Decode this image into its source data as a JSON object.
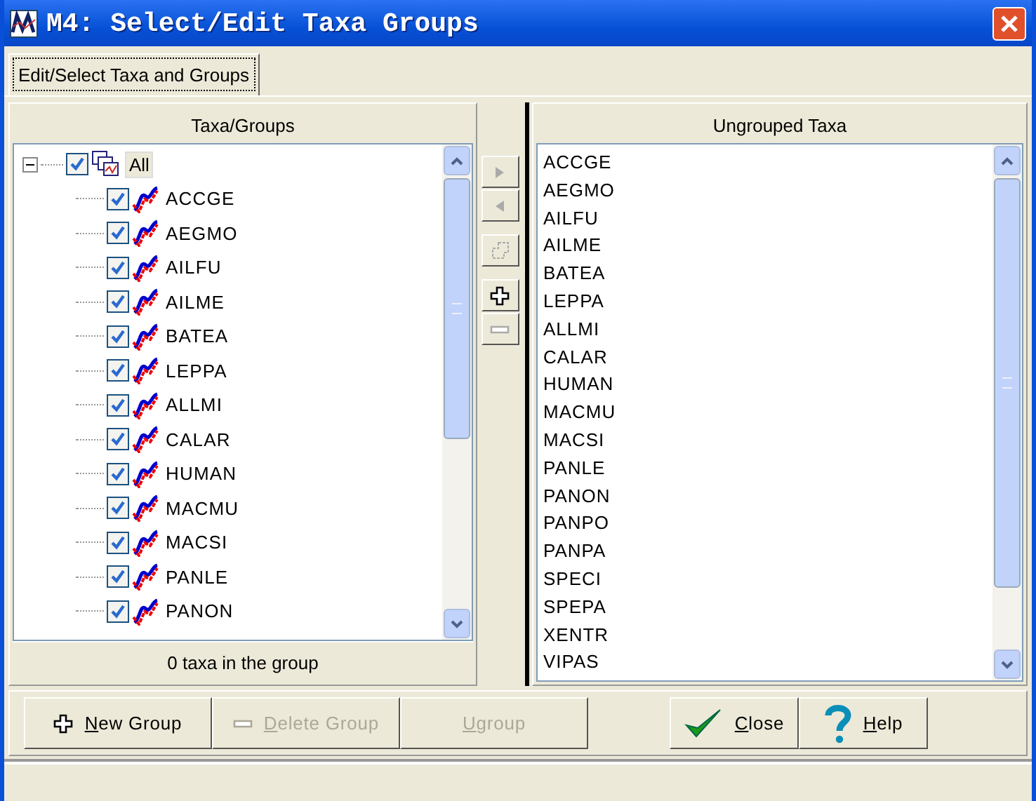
{
  "window": {
    "title": "M4: Select/Edit Taxa Groups"
  },
  "tabs": [
    {
      "label": "Edit/Select Taxa and Groups",
      "selected": true
    }
  ],
  "groups_panel": {
    "header": "Taxa/Groups",
    "footer": "0 taxa in the group",
    "tree": [
      {
        "label": "All",
        "checked": true,
        "expanded": true,
        "selected": true,
        "kind": "group",
        "children": [
          {
            "label": "ACCGE",
            "checked": true,
            "kind": "taxon"
          },
          {
            "label": "AEGMO",
            "checked": true,
            "kind": "taxon"
          },
          {
            "label": "AILFU",
            "checked": true,
            "kind": "taxon"
          },
          {
            "label": "AILME",
            "checked": true,
            "kind": "taxon"
          },
          {
            "label": "BATEA",
            "checked": true,
            "kind": "taxon"
          },
          {
            "label": "LEPPA",
            "checked": true,
            "kind": "taxon"
          },
          {
            "label": "ALLMI",
            "checked": true,
            "kind": "taxon"
          },
          {
            "label": "CALAR",
            "checked": true,
            "kind": "taxon"
          },
          {
            "label": "HUMAN",
            "checked": true,
            "kind": "taxon"
          },
          {
            "label": "MACMU",
            "checked": true,
            "kind": "taxon"
          },
          {
            "label": "MACSI",
            "checked": true,
            "kind": "taxon"
          },
          {
            "label": "PANLE",
            "checked": true,
            "kind": "taxon"
          },
          {
            "label": "PANON",
            "checked": true,
            "kind": "taxon"
          }
        ]
      }
    ]
  },
  "middle_buttons": [
    {
      "kind": "move-right",
      "disabled": true
    },
    {
      "kind": "move-left",
      "disabled": true
    },
    {
      "kind": "group",
      "disabled": true
    },
    {
      "kind": "plus",
      "disabled": false
    },
    {
      "kind": "minus",
      "disabled": true
    }
  ],
  "ungrouped_panel": {
    "header": "Ungrouped Taxa",
    "items": [
      "ACCGE",
      "AEGMO",
      "AILFU",
      "AILME",
      "BATEA",
      "LEPPA",
      "ALLMI",
      "CALAR",
      "HUMAN",
      "MACMU",
      "MACSI",
      "PANLE",
      "PANON",
      "PANPO",
      "PANPA",
      "SPECI",
      "SPEPA",
      "XENTR",
      "VIPAS"
    ]
  },
  "buttons": [
    {
      "label": "New Group",
      "kind": "plus",
      "disabled": false
    },
    {
      "label": "Delete Group",
      "kind": "minus",
      "disabled": true
    },
    {
      "label": "Ugroup",
      "kind": "none",
      "disabled": true
    },
    {
      "label": "Close",
      "kind": "check",
      "disabled": false
    },
    {
      "label": "Help",
      "kind": "help",
      "disabled": false
    }
  ]
}
